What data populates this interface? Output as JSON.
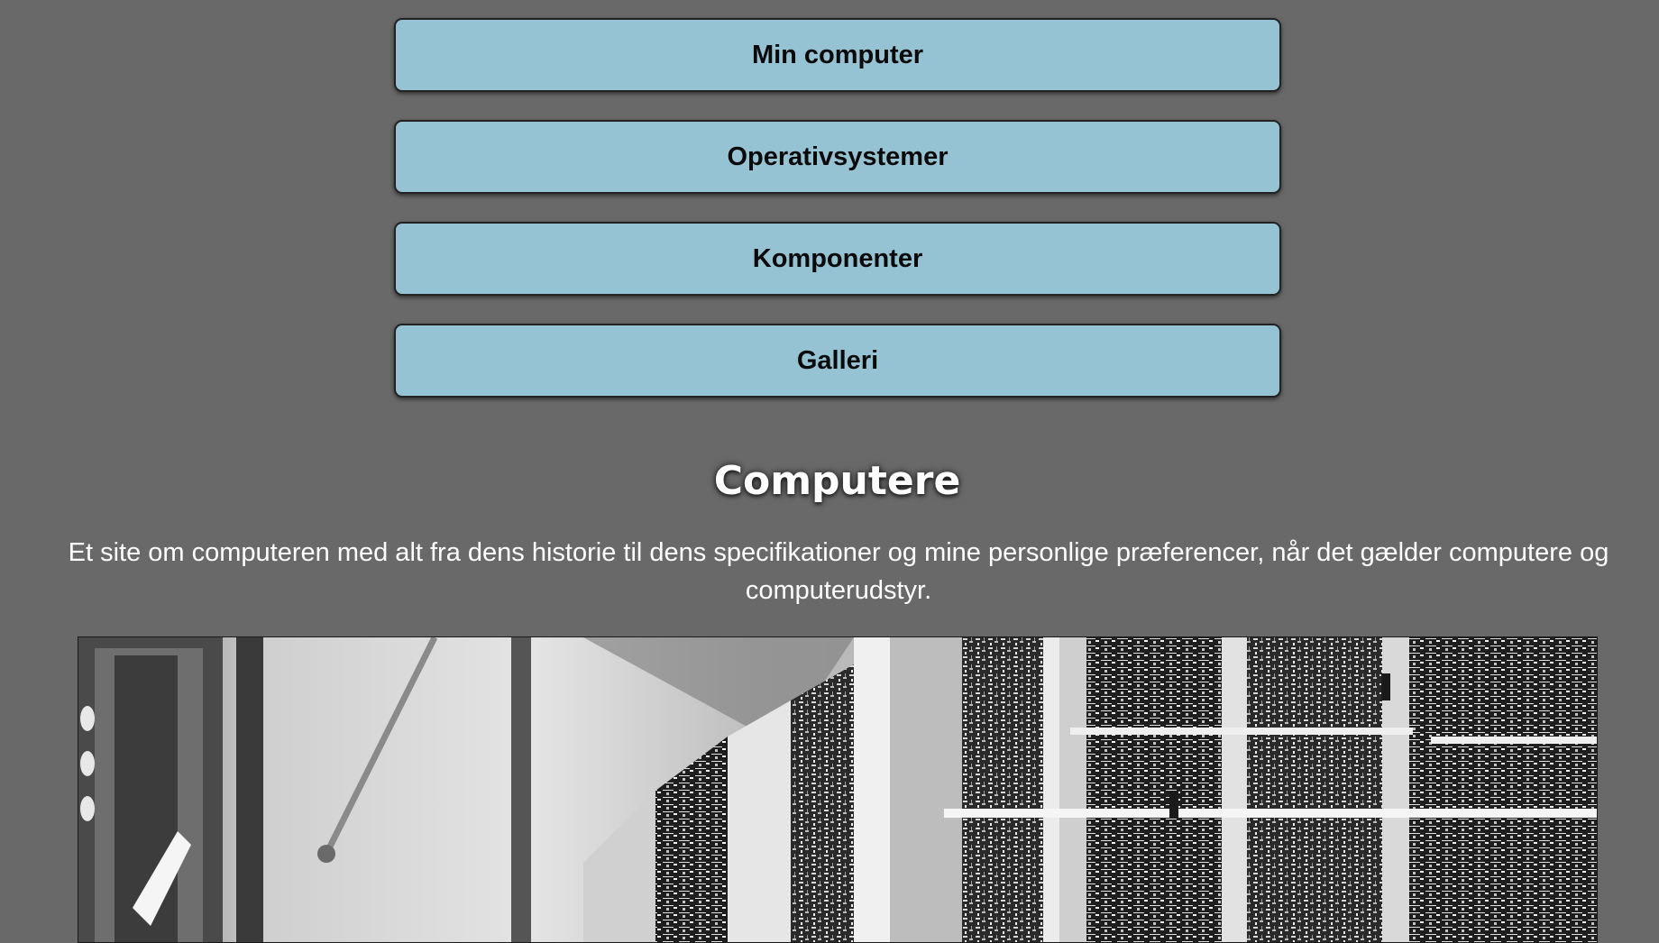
{
  "nav": {
    "items": [
      {
        "label": "Min computer"
      },
      {
        "label": "Operativsystemer"
      },
      {
        "label": "Komponenter"
      },
      {
        "label": "Galleri"
      }
    ]
  },
  "main": {
    "title": "Computere",
    "intro": "Et site om computeren med alt fra dens historie til dens specifikationer og mine personlige præferencer, når det gælder computere og computerudstyr."
  },
  "colors": {
    "page_background": "#696969",
    "button_background": "#96c3d3",
    "button_border": "#222222"
  },
  "hero_image": {
    "icon": "vintage-computer-photo"
  }
}
